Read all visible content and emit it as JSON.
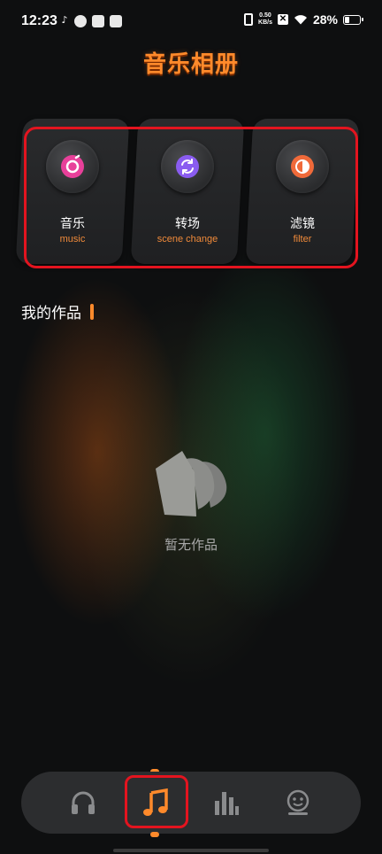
{
  "status_bar": {
    "time": "12:23",
    "net_speed_value": "0.50",
    "net_speed_unit": "KB/s",
    "battery_percent": "28%",
    "battery_level": 0.28
  },
  "app": {
    "title": "音乐相册"
  },
  "features": [
    {
      "label": "音乐",
      "sublabel": "music",
      "icon": "music-disc-icon",
      "color": "#e8409a"
    },
    {
      "label": "转场",
      "sublabel": "scene change",
      "icon": "transition-icon",
      "color": "#8a5cf0"
    },
    {
      "label": "滤镜",
      "sublabel": "filter",
      "icon": "filter-icon",
      "color": "#f06a3a"
    }
  ],
  "works": {
    "title": "我的作品",
    "empty_text": "暂无作品"
  },
  "bottom_nav": {
    "items": [
      {
        "icon": "headphones-icon",
        "active": false
      },
      {
        "icon": "music-note-icon",
        "active": true
      },
      {
        "icon": "equalizer-icon",
        "active": false
      },
      {
        "icon": "profile-icon",
        "active": false
      }
    ],
    "active_color": "#ff8a2b",
    "inactive_color": "#8a8b8d"
  }
}
